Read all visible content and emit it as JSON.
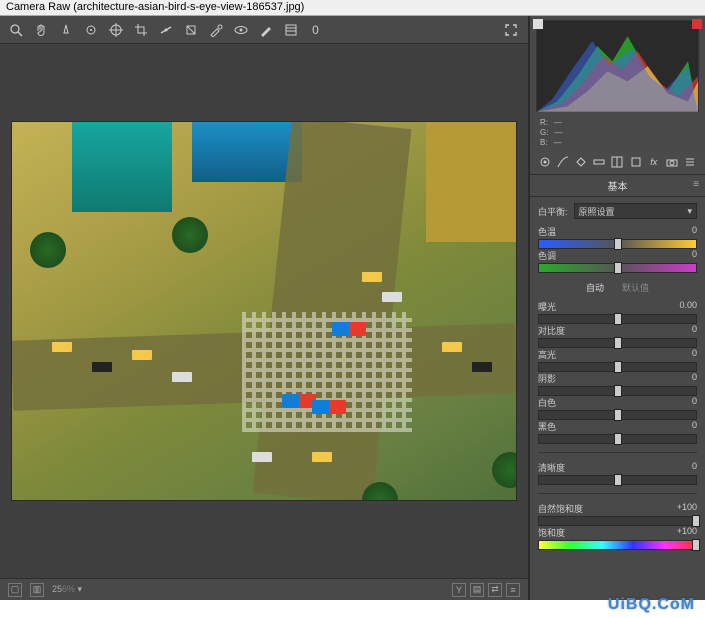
{
  "titlebar": "Camera Raw (architecture-asian-bird-s-eye-view-186537.jpg)",
  "toolbar": {
    "zoom_icon": "zoom",
    "hand_icon": "hand",
    "wb_icon": "white-balance",
    "crop_icon": "color-sample",
    "target_icon": "target-adjust",
    "crop2_icon": "crop",
    "rotate_icon": "straighten",
    "transform_icon": "transform",
    "brush_icon": "spot-removal",
    "eye_icon": "red-eye",
    "adj_icon": "adjustment-brush",
    "grad_icon": "graduated-filter",
    "radial_icon": "radial-filter",
    "rotate_value": "0",
    "fullscreen_icon": "fullscreen"
  },
  "bottombar": {
    "grid1_icon": "single-view",
    "grid2_icon": "split-view",
    "zoom": "25",
    "zoom_suffix": "6%",
    "arrow": "▾",
    "right_icons": [
      "Y",
      "split",
      "swap",
      "menu"
    ]
  },
  "histogram": {
    "shadow_clip": false,
    "highlight_clip": true
  },
  "rgb": {
    "r_label": "R:",
    "g_label": "G:",
    "b_label": "B:",
    "r_val": "—",
    "g_val": "—",
    "b_val": "—"
  },
  "panel_tabs": [
    "basic",
    "curve",
    "detail",
    "hsl",
    "split",
    "lens",
    "fx",
    "camera",
    "preset"
  ],
  "panel_title": "基本",
  "wb": {
    "label": "白平衡:",
    "selected": "原照设置"
  },
  "auto": {
    "auto": "自动",
    "default": "默认值"
  },
  "sliders_top": [
    {
      "label": "色温",
      "value": "0",
      "thumb": 50,
      "style": "gradient-temp"
    },
    {
      "label": "色调",
      "value": "0",
      "thumb": 50,
      "style": "gradient-tint"
    }
  ],
  "sliders_mid": [
    {
      "label": "曝光",
      "value": "0.00",
      "thumb": 50,
      "style": ""
    },
    {
      "label": "对比度",
      "value": "0",
      "thumb": 50,
      "style": ""
    },
    {
      "label": "高光",
      "value": "0",
      "thumb": 50,
      "style": ""
    },
    {
      "label": "阴影",
      "value": "0",
      "thumb": 50,
      "style": ""
    },
    {
      "label": "白色",
      "value": "0",
      "thumb": 50,
      "style": ""
    },
    {
      "label": "黑色",
      "value": "0",
      "thumb": 50,
      "style": ""
    }
  ],
  "sliders_bot": [
    {
      "label": "清晰度",
      "value": "0",
      "thumb": 50,
      "style": ""
    }
  ],
  "sliders_sat": [
    {
      "label": "自然饱和度",
      "value": "+100",
      "thumb": 100,
      "style": ""
    },
    {
      "label": "饱和度",
      "value": "+100",
      "thumb": 100,
      "style": "gradient-rainbow"
    }
  ],
  "footer_link_icon": "workflow-options",
  "watermark": "UiBQ.CoM"
}
